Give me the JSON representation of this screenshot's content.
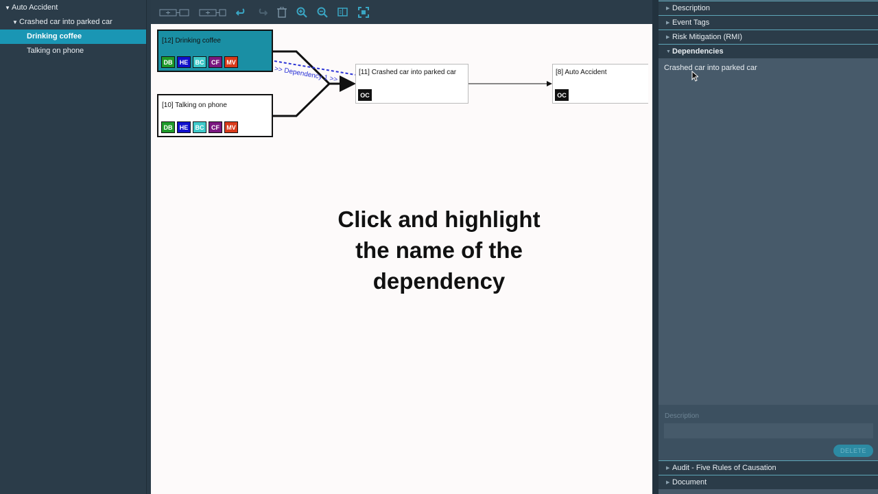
{
  "tree": {
    "items": [
      {
        "label": "Auto Accident",
        "level": 0,
        "expanded": true,
        "selected": false
      },
      {
        "label": "Crashed car into parked car",
        "level": 1,
        "expanded": true,
        "selected": false
      },
      {
        "label": "Drinking coffee",
        "level": 2,
        "expanded": false,
        "selected": true
      },
      {
        "label": "Talking on phone",
        "level": 2,
        "expanded": false,
        "selected": false
      }
    ]
  },
  "toolbar": {
    "buttons": [
      "add-child-icon",
      "add-sibling-icon",
      "undo-icon",
      "redo-icon",
      "delete-icon",
      "zoom-in-icon",
      "zoom-out-icon",
      "fit-icon",
      "expand-icon"
    ]
  },
  "canvas": {
    "nodes": [
      {
        "id": "n12",
        "title": "[12] Drinking coffee",
        "kind": "cause",
        "selected": true,
        "tags": [
          {
            "t": "DB",
            "c": "#1f9a2a"
          },
          {
            "t": "HE",
            "c": "#1010cc"
          },
          {
            "t": "BC",
            "c": "#3ec9c9"
          },
          {
            "t": "CF",
            "c": "#7a1880"
          },
          {
            "t": "MV",
            "c": "#d83a1a"
          }
        ]
      },
      {
        "id": "n10",
        "title": "[10] Talking on phone",
        "kind": "cause",
        "selected": false,
        "tags": [
          {
            "t": "DB",
            "c": "#1f9a2a"
          },
          {
            "t": "HE",
            "c": "#1010cc"
          },
          {
            "t": "BC",
            "c": "#3ec9c9"
          },
          {
            "t": "CF",
            "c": "#7a1880"
          },
          {
            "t": "MV",
            "c": "#d83a1a"
          }
        ]
      },
      {
        "id": "n11",
        "title": "[11] Crashed car into parked car",
        "kind": "effect",
        "badge": "OC"
      },
      {
        "id": "n8",
        "title": "[8] Auto Accident",
        "kind": "effect",
        "badge": "OC"
      }
    ],
    "dependency_label": ">> Dependency 1 >>",
    "caption": [
      "Click and highlight",
      "the name of the",
      "dependency"
    ]
  },
  "panel": {
    "sections": [
      "Description",
      "Event Tags",
      "Risk Mitigation (RMI)",
      "Dependencies"
    ],
    "open_section": "Dependencies",
    "dependency_item": "Crashed car into parked car",
    "description_label": "Description",
    "description_value": "",
    "delete_label": "DELETE",
    "bottom_sections": [
      "Audit - Five Rules of Causation",
      "Document"
    ]
  },
  "colors": {
    "accent": "#1a96b4",
    "panel_bg": "#475a6a",
    "dependency_line": "#2b33d6"
  }
}
